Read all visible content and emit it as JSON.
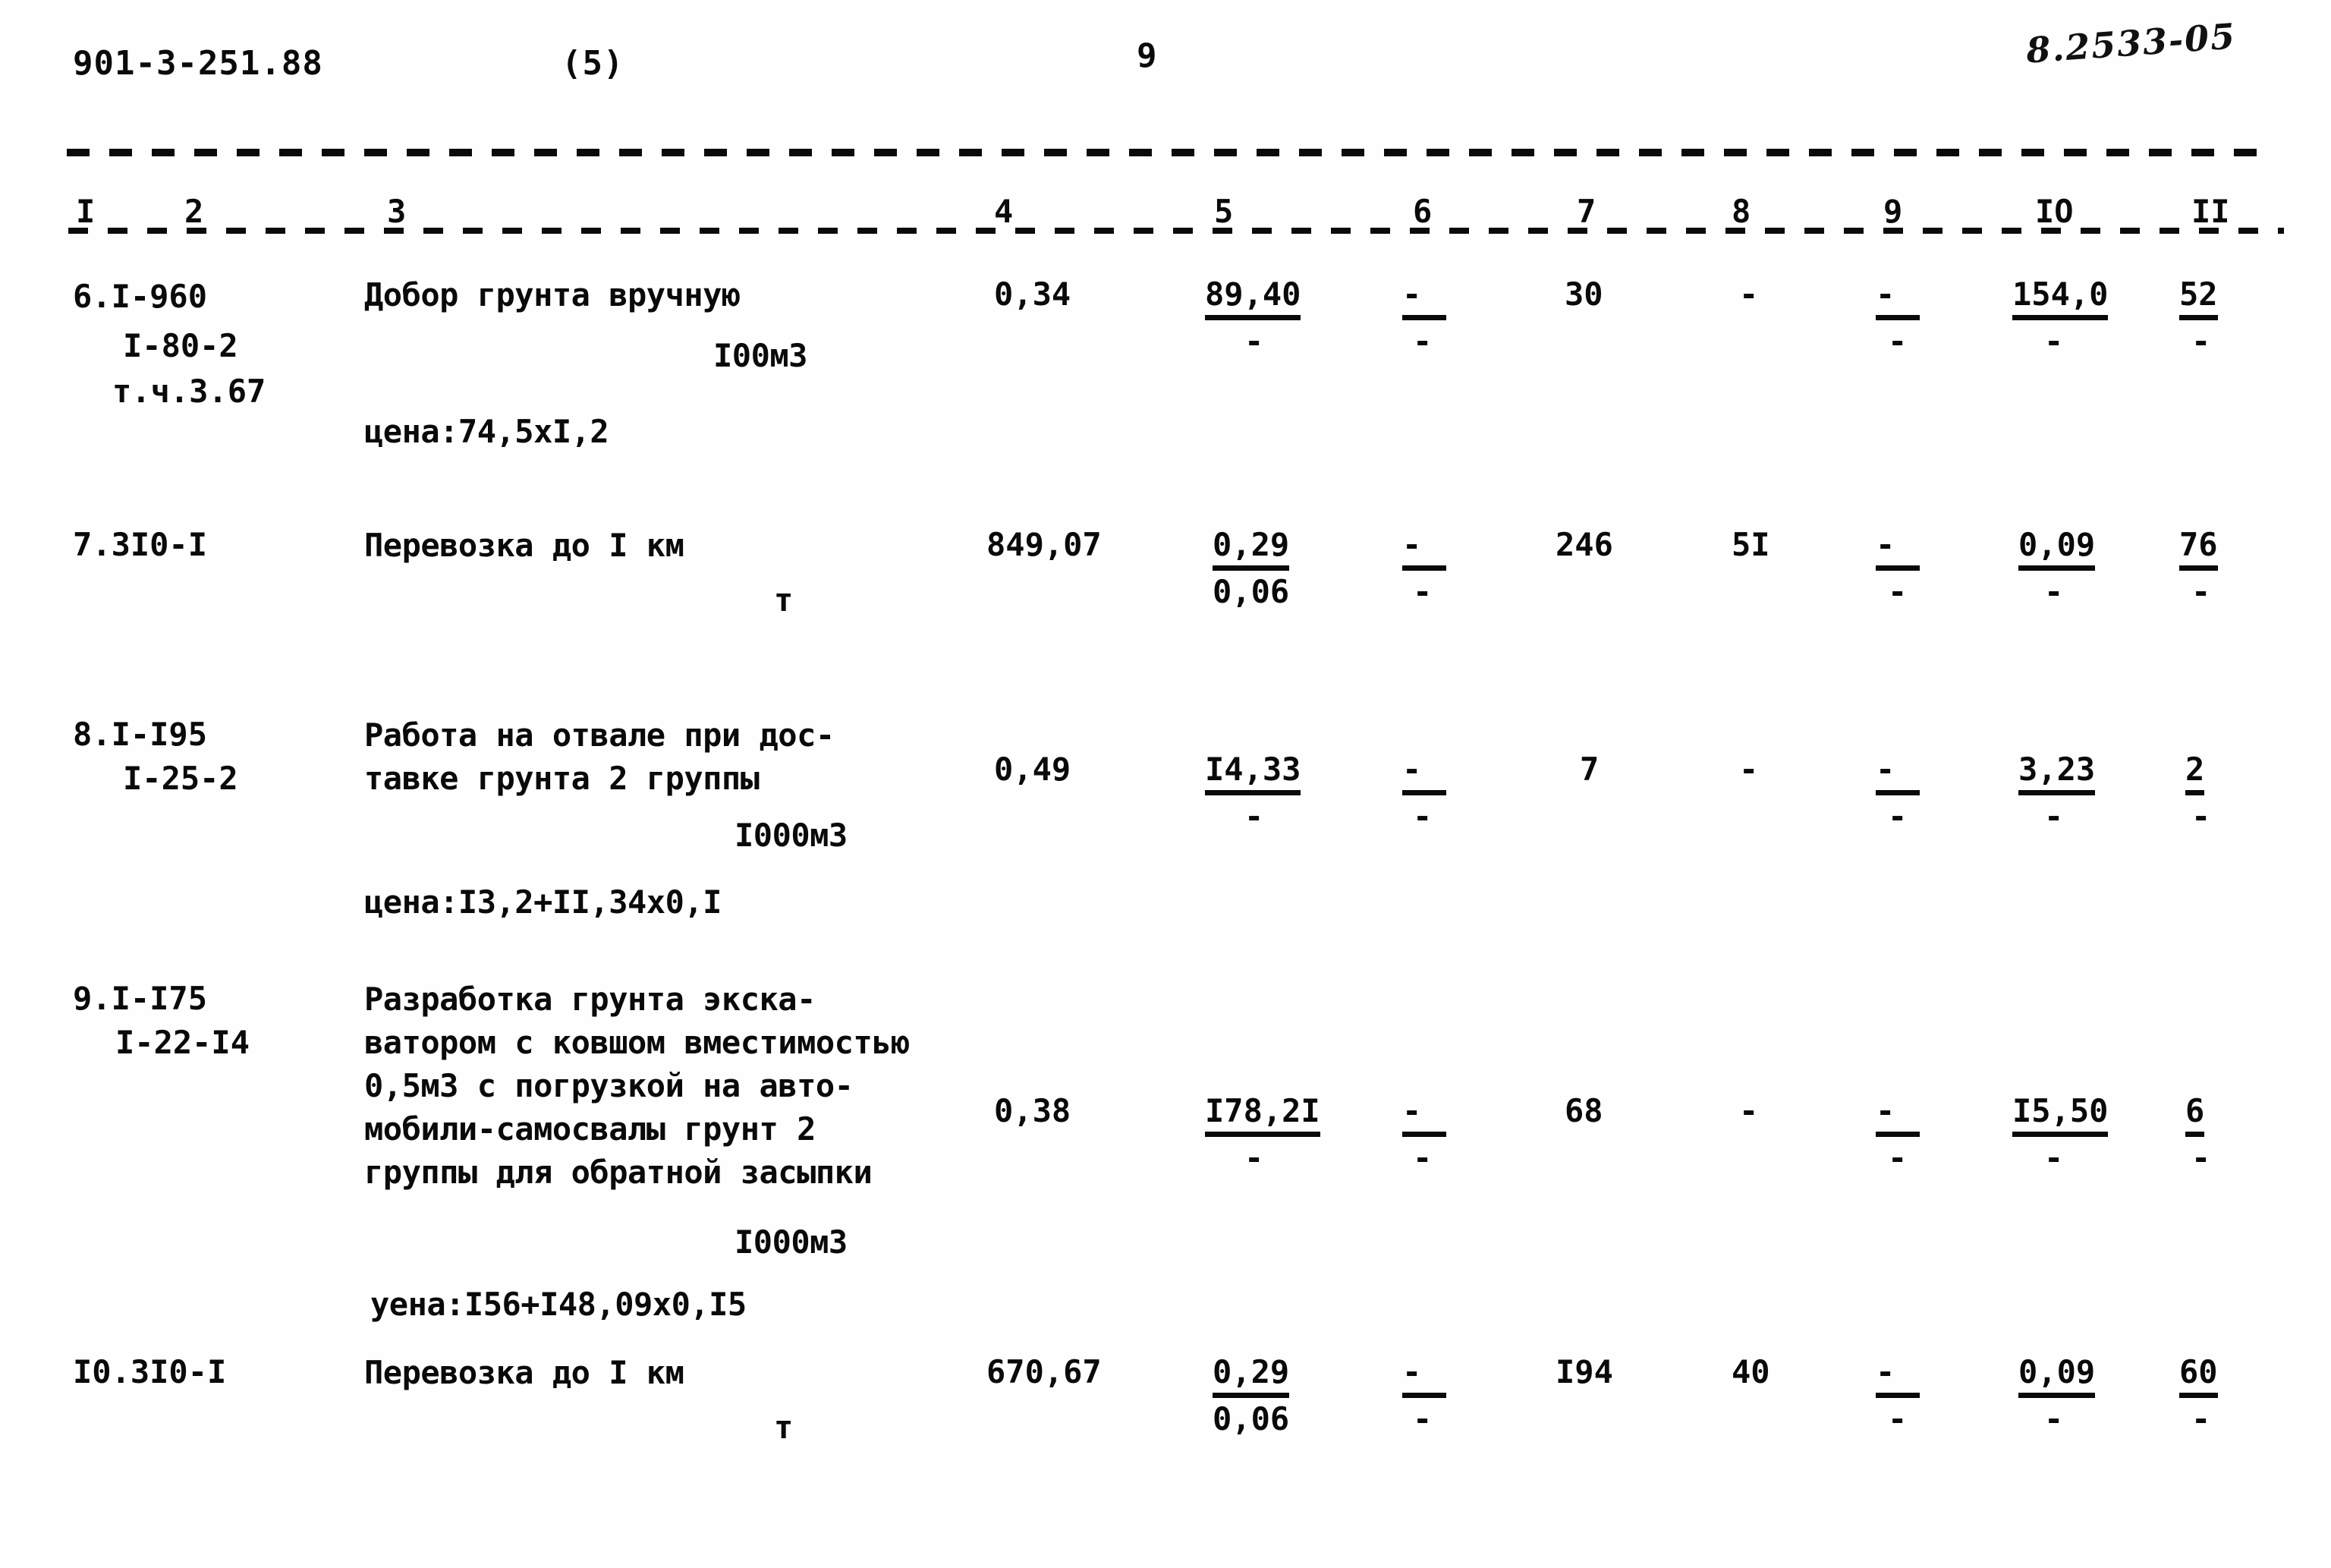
{
  "header": {
    "document_code": "901-3-251.88",
    "sheet_marker": "(5)",
    "page_number": "9",
    "handwritten_note": "8.2533-05"
  },
  "table": {
    "column_numbers": [
      "I",
      "2",
      "3",
      "4",
      "5",
      "6",
      "7",
      "8",
      "9",
      "IO",
      "II"
    ],
    "rows": [
      {
        "position": "6.I-960",
        "code_line_2": "I-80-2",
        "code_line_3": "т.ч.3.67",
        "description_lines": [
          "Добор грунта вручную"
        ],
        "unit": "I00м3",
        "price_note": "цена:74,5xI,2",
        "col4": "0,34",
        "col5_top": "89,40",
        "col5_bottom": "-",
        "col6_top": "-",
        "col6_bottom": "-",
        "col7": "30",
        "col8": "-",
        "col9_top": "-",
        "col9_bottom": "-",
        "col10_top": "154,0",
        "col10_bottom": "-",
        "col11_top": "52",
        "col11_bottom": "-"
      },
      {
        "position": "7.3I0-I",
        "code_line_2": "",
        "code_line_3": "",
        "description_lines": [
          "Перевозка до I км"
        ],
        "unit": "т",
        "price_note": "",
        "col4": "849,07",
        "col5_top": "0,29",
        "col5_bottom": "0,06",
        "col6_top": "-",
        "col6_bottom": "-",
        "col7": "246",
        "col8": "5I",
        "col9_top": "-",
        "col9_bottom": "-",
        "col10_top": "0,09",
        "col10_bottom": "-",
        "col11_top": "76",
        "col11_bottom": "-"
      },
      {
        "position": "8.I-I95",
        "code_line_2": "I-25-2",
        "code_line_3": "",
        "description_lines": [
          "Работа на отвале при дос-",
          "тавке грунта 2 группы"
        ],
        "unit": "I000м3",
        "price_note": "цена:I3,2+II,34x0,I",
        "col4": "0,49",
        "col5_top": "I4,33",
        "col5_bottom": "-",
        "col6_top": "-",
        "col6_bottom": "-",
        "col7": "7",
        "col8": "-",
        "col9_top": "-",
        "col9_bottom": "-",
        "col10_top": "3,23",
        "col10_bottom": "-",
        "col11_top": "2",
        "col11_bottom": "-"
      },
      {
        "position": "9.I-I75",
        "code_line_2": "I-22-I4",
        "code_line_3": "",
        "description_lines": [
          "Разработка грунта экска-",
          "ватором с ковшом вместимостью",
          "0,5м3 с погрузкой на авто-",
          "мобили-самосвалы грунт 2",
          "группы для обратной засыпки"
        ],
        "unit": "I000м3",
        "price_note": "уена:I56+I48,09x0,I5",
        "col4": "0,38",
        "col5_top": "I78,2I",
        "col5_bottom": "-",
        "col6_top": "-",
        "col6_bottom": "-",
        "col7": "68",
        "col8": "-",
        "col9_top": "-",
        "col9_bottom": "-",
        "col10_top": "I5,50",
        "col10_bottom": "-",
        "col11_top": "6",
        "col11_bottom": "-"
      },
      {
        "position": "I0.3I0-I",
        "code_line_2": "",
        "code_line_3": "",
        "description_lines": [
          "Перевозка до I км"
        ],
        "unit": "т",
        "price_note": "",
        "col4": "670,67",
        "col5_top": "0,29",
        "col5_bottom": "0,06",
        "col6_top": "-",
        "col6_bottom": "-",
        "col7": "I94",
        "col8": "40",
        "col9_top": "-",
        "col9_bottom": "-",
        "col10_top": "0,09",
        "col10_bottom": "-",
        "col11_top": "60",
        "col11_bottom": "-"
      }
    ]
  }
}
